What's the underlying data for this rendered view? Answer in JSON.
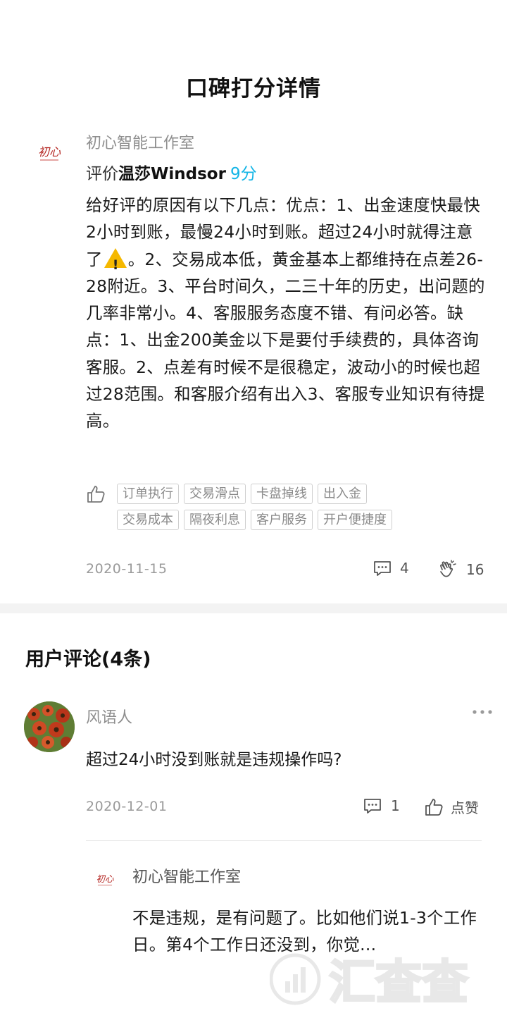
{
  "page": {
    "title": "口碑打分详情"
  },
  "review": {
    "author": "初心智能工作室",
    "rating_prefix": "评价",
    "rating_target": "温莎Windsor",
    "score": "9分",
    "text_before_icon": "给好评的原因有以下几点：优点：1、出金速度快最快2小时到账，最慢24小时到账。超过24小时就得注意了",
    "text_after_icon": "。2、交易成本低，黄金基本上都维持在点差26-28附近。3、平台时间久，二三十年的历史，出问题的几率非常小。4、客服服务态度不错、有问必答。缺点：1、出金200美金以下是要付手续费的，具体咨询客服。2、点差有时候不是很稳定，波动小的时候也超过28范围。和客服介绍有出入3、客服专业知识有待提高。",
    "tags": [
      "订单执行",
      "交易滑点",
      "卡盘掉线",
      "出入金",
      "交易成本",
      "隔夜利息",
      "客户服务",
      "开户便捷度"
    ],
    "date": "2020-11-15",
    "comment_count": "4",
    "clap_count": "16"
  },
  "comments": {
    "title": "用户评论(4条)",
    "items": [
      {
        "user": "风语人",
        "text": "超过24小时没到账就是违规操作吗?",
        "date": "2020-12-01",
        "reply_count": "1",
        "like_label": "点赞",
        "reply": {
          "author": "初心智能工作室",
          "text": "不是违规，是有问题了。比如他们说1-3个工作日。第4个工作日还没到，你觉..."
        }
      }
    ]
  },
  "watermark": {
    "text": "汇查查"
  },
  "colors": {
    "accent": "#14b5e6",
    "muted": "#9a9a9a"
  }
}
